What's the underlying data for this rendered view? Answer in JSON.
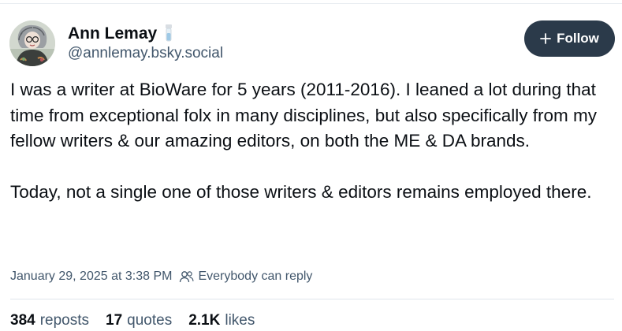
{
  "author": {
    "display_name": "Ann Lemay",
    "handle": "@annlemay.bsky.social",
    "avatar": "avatar-illustration",
    "badge_icon": "vial-icon"
  },
  "follow_button": {
    "icon": "plus-icon",
    "label": "Follow"
  },
  "post": {
    "text": "I was a writer at BioWare for 5 years (2011-2016). I leaned a lot during that time from exceptional folx in many disciplines, but also specifically from my fellow writers & our amazing editors, on both the ME & DA brands.\n\nToday, not a single one of those writers & editors remains employed there.",
    "timestamp": "January 29, 2025 at 3:38 PM",
    "reply_setting_icon": "people-icon",
    "reply_setting": "Everybody can reply"
  },
  "stats": {
    "reposts_count": "384",
    "reposts_label": "reposts",
    "quotes_count": "17",
    "quotes_label": "quotes",
    "likes_count": "2.1K",
    "likes_label": "likes"
  },
  "colors": {
    "text_primary": "#0b0f14",
    "text_secondary": "#42576c",
    "follow_bg": "#2b3a4a",
    "divider": "#dfe5eb"
  }
}
